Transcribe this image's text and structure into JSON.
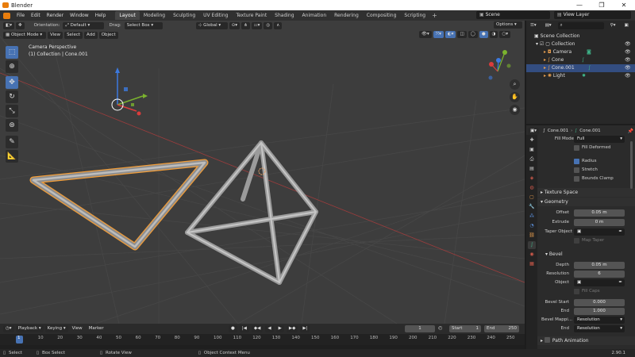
{
  "window": {
    "title": "Blender",
    "controls": [
      "—",
      "❐",
      "✕"
    ]
  },
  "menu": [
    "File",
    "Edit",
    "Render",
    "Window",
    "Help"
  ],
  "workspaces": [
    "Layout",
    "Modeling",
    "Sculpting",
    "UV Editing",
    "Texture Paint",
    "Shading",
    "Animation",
    "Rendering",
    "Compositing",
    "Scripting"
  ],
  "active_workspace": "Layout",
  "scene": {
    "name": "Scene",
    "view_layer": "View Layer"
  },
  "tool_header": {
    "orientation_label": "Orientation:",
    "orientation_value": "Default",
    "drag_label": "Drag:",
    "drag_value": "Select Box",
    "transform_orientation": "Global",
    "options": "Options"
  },
  "viewport_header": {
    "mode": "Object Mode",
    "menus": [
      "View",
      "Select",
      "Add",
      "Object"
    ]
  },
  "viewport_overlay": {
    "line1": "Camera Perspective",
    "line2": "(1) Collection | Cone.001"
  },
  "gizmo_axes": [
    "Z",
    "Y",
    "X"
  ],
  "outliner": {
    "search_placeholder": "",
    "items": [
      {
        "label": "Scene Collection"
      },
      {
        "label": "Collection"
      },
      {
        "label": "Camera"
      },
      {
        "label": "Cone"
      },
      {
        "label": "Cone.001"
      },
      {
        "label": "Light"
      }
    ]
  },
  "properties": {
    "object_name": "Cone.001",
    "data_name": "Cone.001",
    "fill_mode_label": "Fill Mode",
    "fill_mode_value": "Full",
    "fill_deformed": "Fill Deformed",
    "radius": "Radius",
    "stretch": "Stretch",
    "bounds_clamp": "Bounds Clamp",
    "texture_space": "Texture Space",
    "geometry": "Geometry",
    "offset_label": "Offset",
    "offset_value": "0.05 m",
    "extrude_label": "Extrude",
    "extrude_value": "0 m",
    "taper_label": "Taper Object",
    "map_taper": "Map Taper",
    "bevel": "Bevel",
    "depth_label": "Depth",
    "depth_value": "0.05 m",
    "resolution_label": "Resolution",
    "resolution_value": "6",
    "object_label": "Object",
    "fill_caps": "Fill Caps",
    "bevel_start_label": "Bevel Start",
    "bevel_start_value": "0.000",
    "end_label": "End",
    "end_value": "1.000",
    "bevel_mapping_label": "Bevel Mappi...",
    "bevel_mapping_value": "Resolution",
    "end2_label": "End",
    "end2_value": "Resolution",
    "path_animation": "Path Animation"
  },
  "timeline": {
    "menus": [
      "Playback",
      "Keying",
      "View",
      "Marker"
    ],
    "current_frame": "1",
    "start_label": "Start",
    "start_value": "1",
    "end_label": "End",
    "end_value": "250",
    "ruler": [
      "1",
      "10",
      "20",
      "30",
      "40",
      "50",
      "60",
      "70",
      "80",
      "90",
      "100",
      "110",
      "120",
      "130",
      "140",
      "150",
      "160",
      "170",
      "180",
      "190",
      "200",
      "210",
      "220",
      "230",
      "240",
      "250"
    ]
  },
  "status": {
    "select": "Select",
    "box_select": "Box Select",
    "rotate": "Rotate View",
    "context": "Object Context Menu",
    "version": "2.90.1"
  },
  "colors": {
    "accent": "#4772b3",
    "selection_orange": "#f29d38",
    "x_axis": "#d93c3c",
    "y_axis": "#7bb32e",
    "z_axis": "#3c7ae0"
  }
}
